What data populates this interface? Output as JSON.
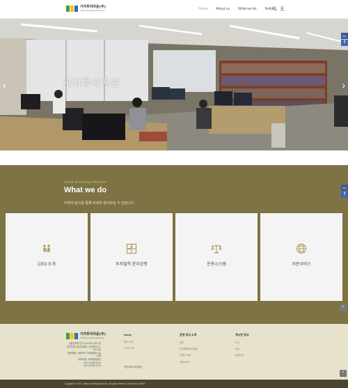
{
  "header": {
    "logo": {
      "name_ko": "가치투자자문(주)",
      "name_en": "Value Investing Advisors"
    },
    "nav": [
      {
        "label": "Home",
        "active": true
      },
      {
        "label": "About us",
        "active": false
      },
      {
        "label": "What we do",
        "active": false
      },
      {
        "label": "Notice",
        "active": false
      }
    ],
    "icons": [
      "search-icon",
      "user-icon"
    ]
  },
  "hero": {
    "title": "가치투자자문",
    "prev_arrow": "‹",
    "next_arrow": "›"
  },
  "social": {
    "lang": "Ko",
    "facebook": "f"
  },
  "services": {
    "subtitle": "Value Investing Advisors",
    "title": "What we do",
    "description": "아래의 링크를 통해 자세히 알아보실 수 있습니다.",
    "cards": [
      {
        "label": "CEO 소개",
        "icon": "people-icon"
      },
      {
        "label": "투자철학 윤리강령",
        "icon": "puzzle-icon"
      },
      {
        "label": "운용시스템",
        "icon": "scale-icon"
      },
      {
        "label": "자문서비스",
        "icon": "globe-icon"
      }
    ],
    "to_top": "^"
  },
  "footer": {
    "logo": {
      "name_ko": "가치투자자문(주)",
      "name_en": "Value Investing Advisors"
    },
    "address_lines": [
      "금융감독원 인가 (110132) 1층 7호",
      "(투자자문 및 일임업체 : 등록번호 10-92-135)",
      "서울특별시 영등포구 국제금융로 2길 11층",
      "(여의도동, 고려증권빌딩)",
      "TEL 02)780-3114",
      "FAX 02)780-0773"
    ],
    "columns": [
      {
        "heading": "Home",
        "links": [
          "회사 소개",
          "CEO 소개"
        ]
      },
      {
        "heading": "운영 방식 소개",
        "links": [
          "업무",
          "투자철학/윤리강령",
          "운용시스템",
          "자문서비스"
        ]
      },
      {
        "heading": "게시판 링크",
        "links": [
          "소식",
          "공시",
          "법정이의"
        ]
      }
    ],
    "policy": "개인정보 처리방침",
    "copyright": "Copyright © 2017, Value Investing Advisors. All rights reserved. Powered by WKH"
  },
  "colors": {
    "brand_olive": "#7e7345",
    "footer_bg": "#e6e2cc",
    "footer_bottom": "#4e452e",
    "accent_gold": "#b8a96a",
    "logo_green": "#4a9a3f",
    "logo_yellow": "#f0c419",
    "logo_blue": "#2e6fb5"
  }
}
